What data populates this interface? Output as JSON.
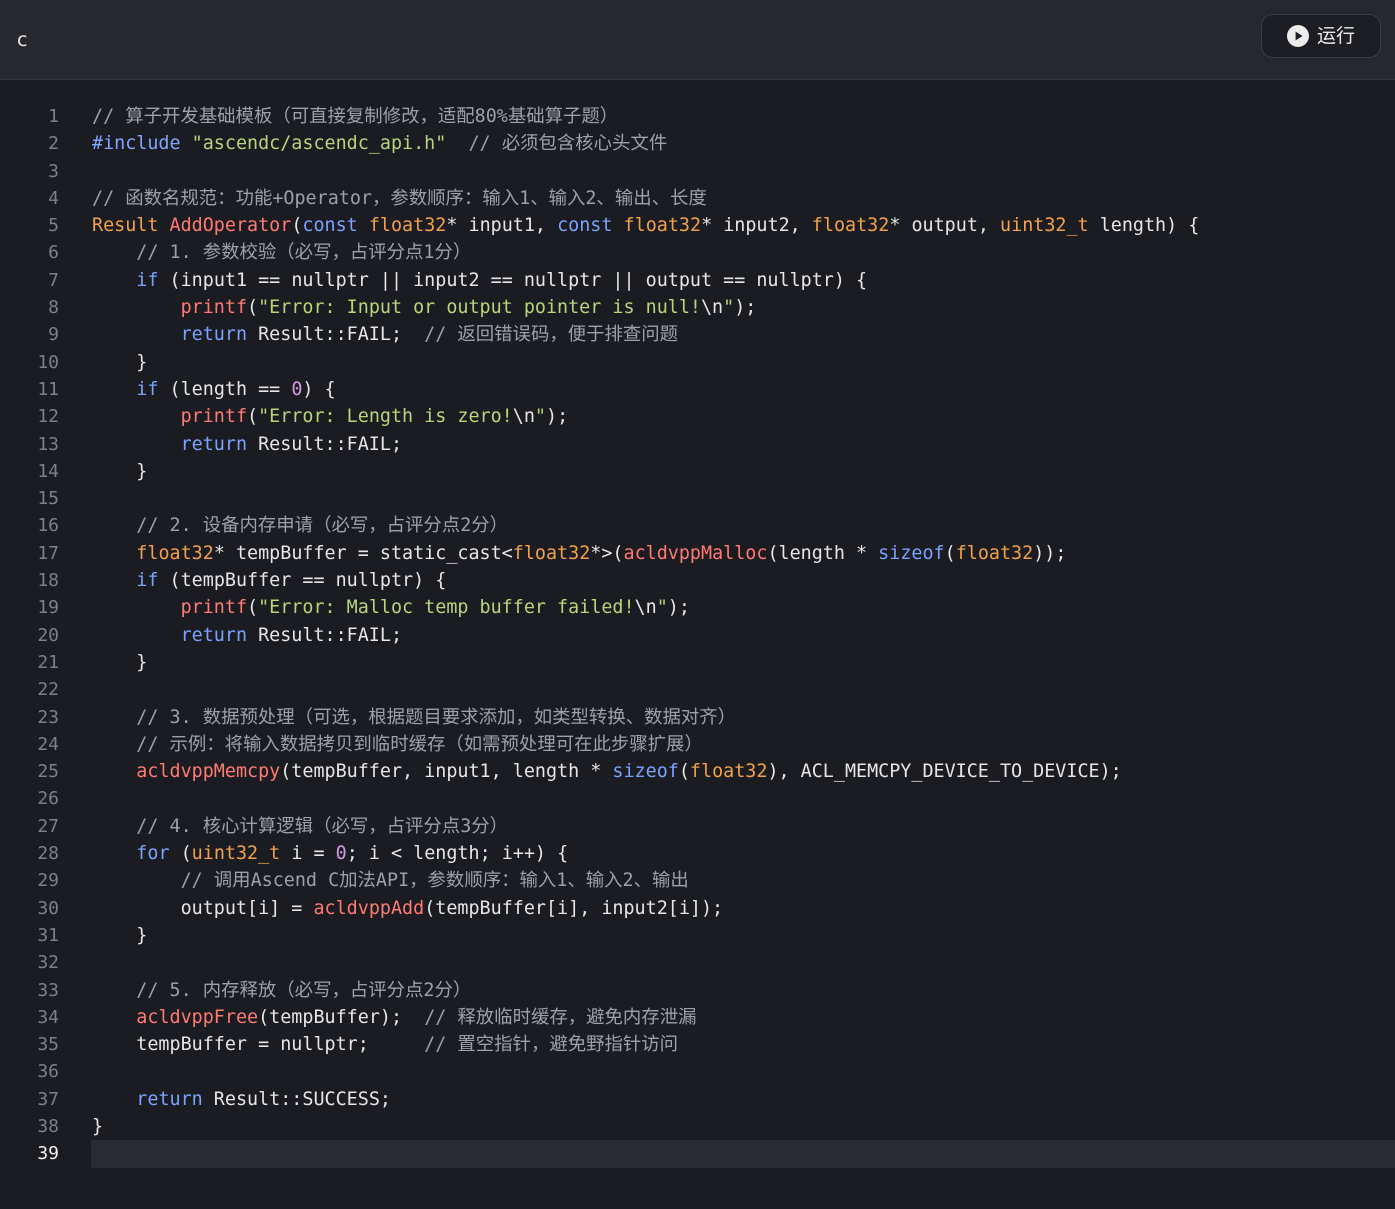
{
  "header": {
    "language": "c",
    "run_button": "运行"
  },
  "editor": {
    "current_line": 39,
    "colors": {
      "background": "#1b1c21",
      "header": "#27282d",
      "keyword": "#7aa3ff",
      "type": "#f0a14a",
      "function": "#ff7a73",
      "string": "#b7d57a",
      "comment": "#9ca0a8",
      "number": "#d39ae3",
      "text": "#e6e6e6"
    },
    "lines": [
      [
        [
          "cmt",
          "// 算子开发基础模板（可直接复制修改，适配80%基础算子题）"
        ]
      ],
      [
        [
          "pp",
          "#include"
        ],
        [
          "txt",
          " "
        ],
        [
          "str",
          "\"ascendc/ascendc_api.h\""
        ],
        [
          "txt",
          "  "
        ],
        [
          "cmt",
          "// 必须包含核心头文件"
        ]
      ],
      [],
      [
        [
          "cmt",
          "// 函数名规范：功能+Operator，参数顺序：输入1、输入2、输出、长度"
        ]
      ],
      [
        [
          "type",
          "Result"
        ],
        [
          "txt",
          " "
        ],
        [
          "fn",
          "AddOperator"
        ],
        [
          "txt",
          "("
        ],
        [
          "kw",
          "const"
        ],
        [
          "txt",
          " "
        ],
        [
          "type",
          "float32"
        ],
        [
          "txt",
          "* input1, "
        ],
        [
          "kw",
          "const"
        ],
        [
          "txt",
          " "
        ],
        [
          "type",
          "float32"
        ],
        [
          "txt",
          "* input2, "
        ],
        [
          "type",
          "float32"
        ],
        [
          "txt",
          "* output, "
        ],
        [
          "type",
          "uint32_t"
        ],
        [
          "txt",
          " length) {"
        ]
      ],
      [
        [
          "txt",
          "    "
        ],
        [
          "cmt",
          "// 1. 参数校验（必写，占评分点1分）"
        ]
      ],
      [
        [
          "txt",
          "    "
        ],
        [
          "kw",
          "if"
        ],
        [
          "txt",
          " (input1 == nullptr || input2 == nullptr || output == nullptr) {"
        ]
      ],
      [
        [
          "txt",
          "        "
        ],
        [
          "fn",
          "printf"
        ],
        [
          "txt",
          "("
        ],
        [
          "str",
          "\"Error: Input or output pointer is null!"
        ],
        [
          "txt",
          "\\n"
        ],
        [
          "str",
          "\""
        ],
        [
          "txt",
          ");"
        ]
      ],
      [
        [
          "txt",
          "        "
        ],
        [
          "kw",
          "return"
        ],
        [
          "txt",
          " Result::FAIL;  "
        ],
        [
          "cmt",
          "// 返回错误码，便于排查问题"
        ]
      ],
      [
        [
          "txt",
          "    }"
        ]
      ],
      [
        [
          "txt",
          "    "
        ],
        [
          "kw",
          "if"
        ],
        [
          "txt",
          " (length == "
        ],
        [
          "num",
          "0"
        ],
        [
          "txt",
          ") {"
        ]
      ],
      [
        [
          "txt",
          "        "
        ],
        [
          "fn",
          "printf"
        ],
        [
          "txt",
          "("
        ],
        [
          "str",
          "\"Error: Length is zero!"
        ],
        [
          "txt",
          "\\n"
        ],
        [
          "str",
          "\""
        ],
        [
          "txt",
          ");"
        ]
      ],
      [
        [
          "txt",
          "        "
        ],
        [
          "kw",
          "return"
        ],
        [
          "txt",
          " Result::FAIL;"
        ]
      ],
      [
        [
          "txt",
          "    }"
        ]
      ],
      [],
      [
        [
          "txt",
          "    "
        ],
        [
          "cmt",
          "// 2. 设备内存申请（必写，占评分点2分）"
        ]
      ],
      [
        [
          "txt",
          "    "
        ],
        [
          "type",
          "float32"
        ],
        [
          "txt",
          "* tempBuffer = static_cast<"
        ],
        [
          "type",
          "float32"
        ],
        [
          "txt",
          "*>("
        ],
        [
          "fn",
          "acldvppMalloc"
        ],
        [
          "txt",
          "(length * "
        ],
        [
          "kw",
          "sizeof"
        ],
        [
          "txt",
          "("
        ],
        [
          "type",
          "float32"
        ],
        [
          "txt",
          "));"
        ]
      ],
      [
        [
          "txt",
          "    "
        ],
        [
          "kw",
          "if"
        ],
        [
          "txt",
          " (tempBuffer == nullptr) {"
        ]
      ],
      [
        [
          "txt",
          "        "
        ],
        [
          "fn",
          "printf"
        ],
        [
          "txt",
          "("
        ],
        [
          "str",
          "\"Error: Malloc temp buffer failed!"
        ],
        [
          "txt",
          "\\n"
        ],
        [
          "str",
          "\""
        ],
        [
          "txt",
          ");"
        ]
      ],
      [
        [
          "txt",
          "        "
        ],
        [
          "kw",
          "return"
        ],
        [
          "txt",
          " Result::FAIL;"
        ]
      ],
      [
        [
          "txt",
          "    }"
        ]
      ],
      [],
      [
        [
          "txt",
          "    "
        ],
        [
          "cmt",
          "// 3. 数据预处理（可选，根据题目要求添加，如类型转换、数据对齐）"
        ]
      ],
      [
        [
          "txt",
          "    "
        ],
        [
          "cmt",
          "// 示例：将输入数据拷贝到临时缓存（如需预处理可在此步骤扩展）"
        ]
      ],
      [
        [
          "txt",
          "    "
        ],
        [
          "fn",
          "acldvppMemcpy"
        ],
        [
          "txt",
          "(tempBuffer, input1, length * "
        ],
        [
          "kw",
          "sizeof"
        ],
        [
          "txt",
          "("
        ],
        [
          "type",
          "float32"
        ],
        [
          "txt",
          "), ACL_MEMCPY_DEVICE_TO_DEVICE);"
        ]
      ],
      [],
      [
        [
          "txt",
          "    "
        ],
        [
          "cmt",
          "// 4. 核心计算逻辑（必写，占评分点3分）"
        ]
      ],
      [
        [
          "txt",
          "    "
        ],
        [
          "kw",
          "for"
        ],
        [
          "txt",
          " ("
        ],
        [
          "type",
          "uint32_t"
        ],
        [
          "txt",
          " i = "
        ],
        [
          "num",
          "0"
        ],
        [
          "txt",
          "; i < length; i++) {"
        ]
      ],
      [
        [
          "txt",
          "        "
        ],
        [
          "cmt",
          "// 调用Ascend C加法API，参数顺序：输入1、输入2、输出"
        ]
      ],
      [
        [
          "txt",
          "        output[i] = "
        ],
        [
          "fn",
          "acldvppAdd"
        ],
        [
          "txt",
          "(tempBuffer[i], input2[i]);"
        ]
      ],
      [
        [
          "txt",
          "    }"
        ]
      ],
      [],
      [
        [
          "txt",
          "    "
        ],
        [
          "cmt",
          "// 5. 内存释放（必写，占评分点2分）"
        ]
      ],
      [
        [
          "txt",
          "    "
        ],
        [
          "fn",
          "acldvppFree"
        ],
        [
          "txt",
          "(tempBuffer);  "
        ],
        [
          "cmt",
          "// 释放临时缓存，避免内存泄漏"
        ]
      ],
      [
        [
          "txt",
          "    tempBuffer = nullptr;     "
        ],
        [
          "cmt",
          "// 置空指针，避免野指针访问"
        ]
      ],
      [],
      [
        [
          "txt",
          "    "
        ],
        [
          "kw",
          "return"
        ],
        [
          "txt",
          " Result::SUCCESS;"
        ]
      ],
      [
        [
          "txt",
          "}"
        ]
      ],
      []
    ]
  }
}
